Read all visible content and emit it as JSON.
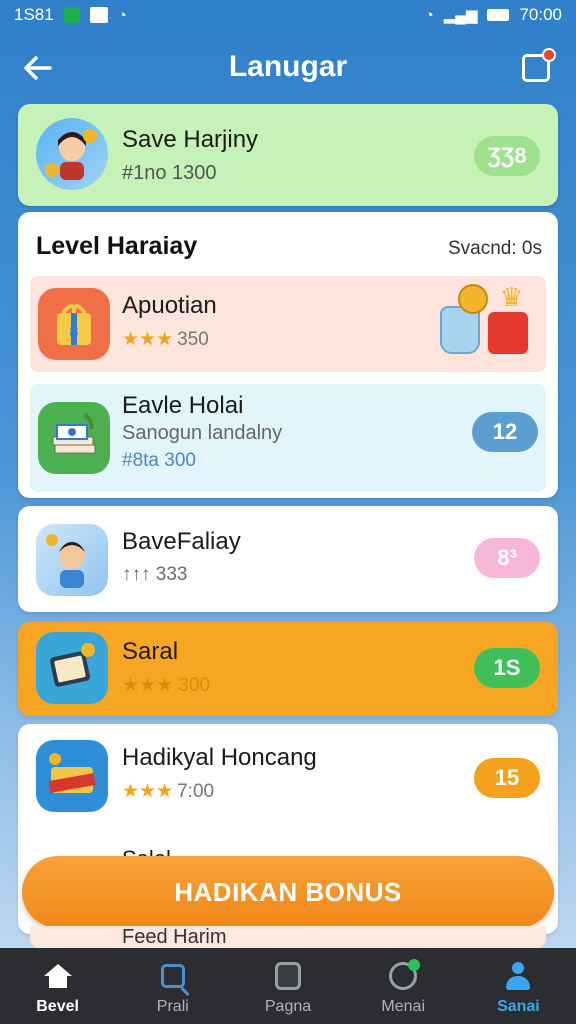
{
  "status_bar": {
    "left_text": "1S81",
    "time": "70:00"
  },
  "header": {
    "title": "Lanugar",
    "back_icon": "arrow-left-icon",
    "notification_icon": "bag-icon"
  },
  "save_card": {
    "title": "Save Harjiny",
    "subtitle": "#1no 1300",
    "badge": "ƷƷ8",
    "badge_color": "#9fe28d"
  },
  "level_panel": {
    "title": "Level Haraiay",
    "status": "Svacnd: 0s",
    "items": [
      {
        "title": "Apuotian",
        "stars": "★★★",
        "value": "350",
        "bg": "#fde4dc"
      },
      {
        "title": "Eavle Holai",
        "subtitle": "Sanogun landalny",
        "meta": "#8ta 300",
        "badge": "12",
        "badge_color": "#5b9fd0"
      }
    ]
  },
  "cards": [
    {
      "title": "BaveFaliay",
      "meta": "↑↑↑ 333",
      "badge": "8³",
      "badge_color": "#f8b6d8"
    },
    {
      "title": "Saral",
      "meta": "★★★ 300",
      "badge": "1S",
      "badge_color": "#3fbf57"
    },
    {
      "title": "Hadikyal Honcang",
      "meta": "★★★ 7:00",
      "badge": "15",
      "badge_color": "#f4a21c"
    }
  ],
  "peek": {
    "partial_title": "Salel",
    "below_title": "Feed Harim"
  },
  "bonus_button": {
    "label": "HADIKAN BONUS"
  },
  "bottom_nav": [
    {
      "label": "Bevel",
      "icon": "home-icon"
    },
    {
      "label": "Prali",
      "icon": "search-icon"
    },
    {
      "label": "Pagna",
      "icon": "page-icon"
    },
    {
      "label": "Menai",
      "icon": "clock-icon"
    },
    {
      "label": "Sanai",
      "icon": "user-icon"
    }
  ]
}
